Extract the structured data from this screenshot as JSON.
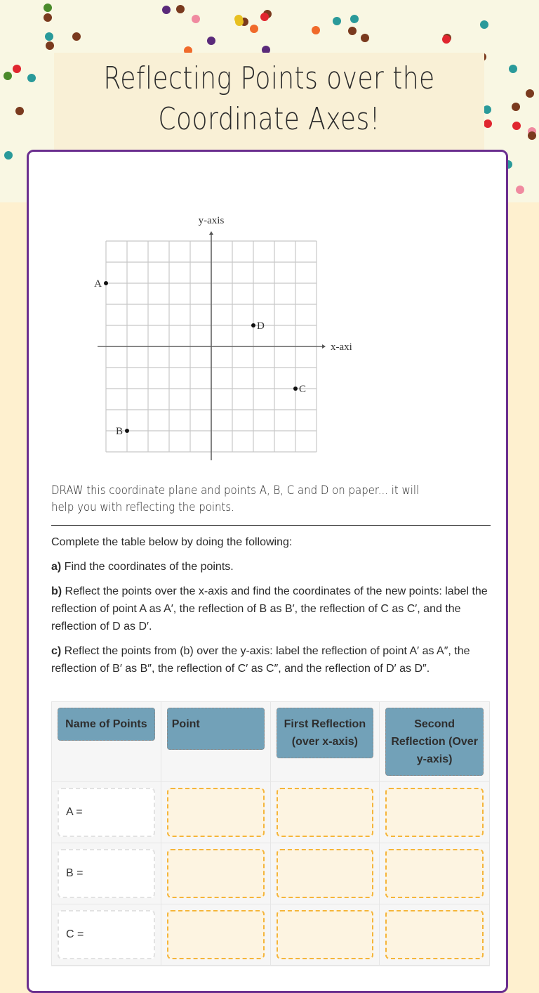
{
  "title": {
    "line1": "Reflecting Points over the",
    "line2": "Coordinate Axes!"
  },
  "colors": {
    "card_border": "#6b2f8f",
    "header_cell": "#72a1b8",
    "input_border": "#f5b53a",
    "input_fill": "#fdf4e1",
    "page_bg": "#fef0cf"
  },
  "graph": {
    "x_label": "x-axis",
    "y_label": "y-axis",
    "x_range": [
      -5,
      5
    ],
    "y_range": [
      -5,
      5
    ],
    "points": [
      {
        "label": "A",
        "x": -5,
        "y": 3,
        "label_side": "left"
      },
      {
        "label": "B",
        "x": -4,
        "y": -4,
        "label_side": "left"
      },
      {
        "label": "C",
        "x": 4,
        "y": -2,
        "label_side": "right"
      },
      {
        "label": "D",
        "x": 2,
        "y": 1,
        "label_side": "right"
      }
    ]
  },
  "draw_note": "DRAW this coordinate plane and points A, B, C and D on paper... it will help you with reflecting the points.",
  "instructions": {
    "intro": "Complete the table below  by doing the following:",
    "a_label": "a)",
    "a_text": " Find the coordinates of the points.",
    "b_label": "b)",
    "b_text": " Reflect the points over the x-axis and find the coordinates of the new points: label the reflection of point A as A′, the reflection of B as B′, the reflection of C as C′, and the reflection of D as D′.",
    "c_label": "c)",
    "c_text": " Reflect the points from (b) over the y-axis: label the reflection of point A′ as A″, the reflection of B′ as B″, the reflection of C′ as C″, and the reflection of D′ as D″."
  },
  "table": {
    "headers": [
      "Name of Points",
      "Point",
      "First Reflection (over x-axis)",
      "Second Reflection (Over y-axis)"
    ],
    "rows": [
      {
        "name": "A =",
        "point": "",
        "first": "",
        "second": ""
      },
      {
        "name": "B =",
        "point": "",
        "first": "",
        "second": ""
      },
      {
        "name": "C =",
        "point": "",
        "first": "",
        "second": ""
      }
    ]
  }
}
